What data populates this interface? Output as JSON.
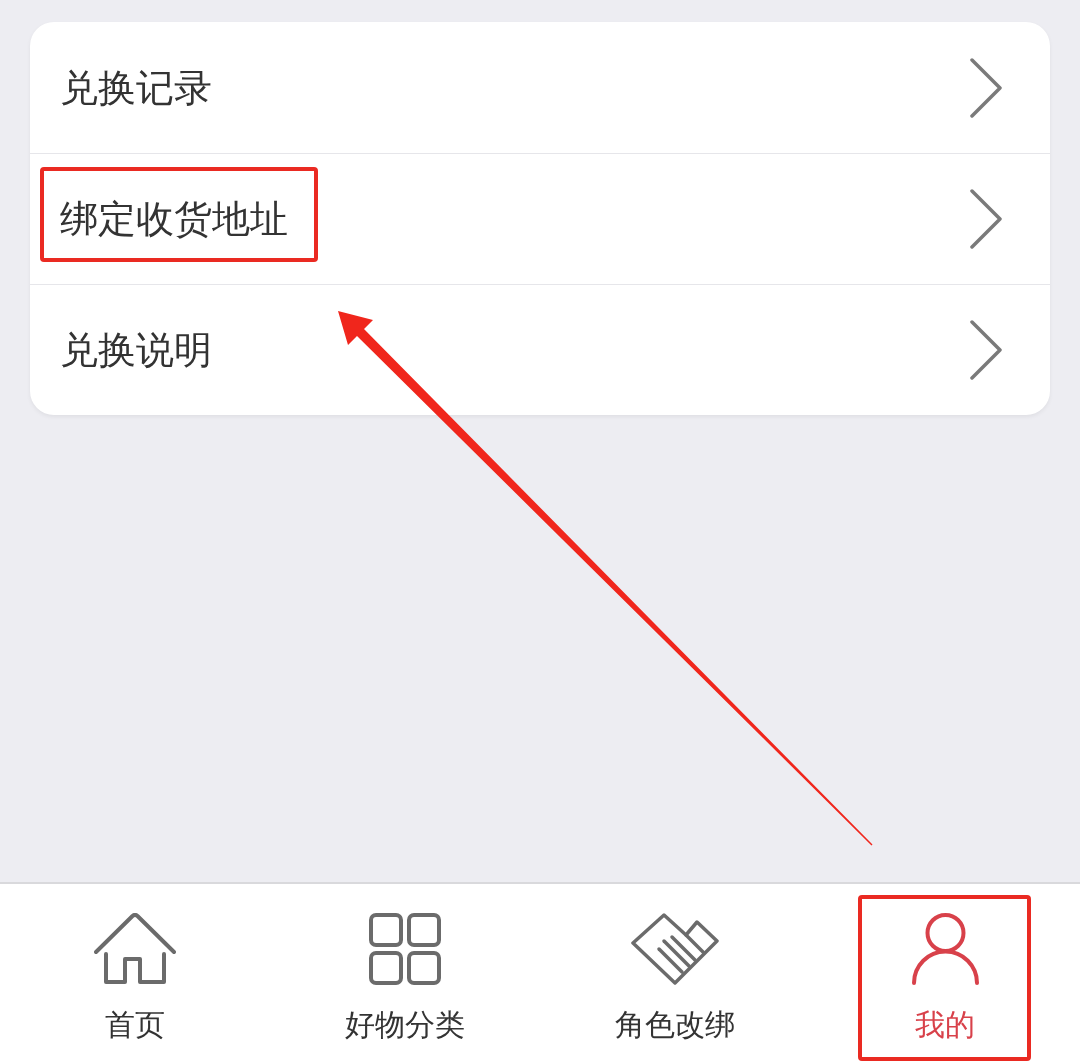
{
  "menu": {
    "items": [
      {
        "label": "兑换记录",
        "highlighted": false
      },
      {
        "label": "绑定收货地址",
        "highlighted": true
      },
      {
        "label": "兑换说明",
        "highlighted": false
      }
    ]
  },
  "tab_bar": {
    "tabs": [
      {
        "label": "首页",
        "selected": false,
        "highlighted": false
      },
      {
        "label": "好物分类",
        "selected": false,
        "highlighted": false
      },
      {
        "label": "角色改绑",
        "selected": false,
        "highlighted": false
      },
      {
        "label": "我的",
        "selected": true,
        "highlighted": true
      }
    ]
  }
}
